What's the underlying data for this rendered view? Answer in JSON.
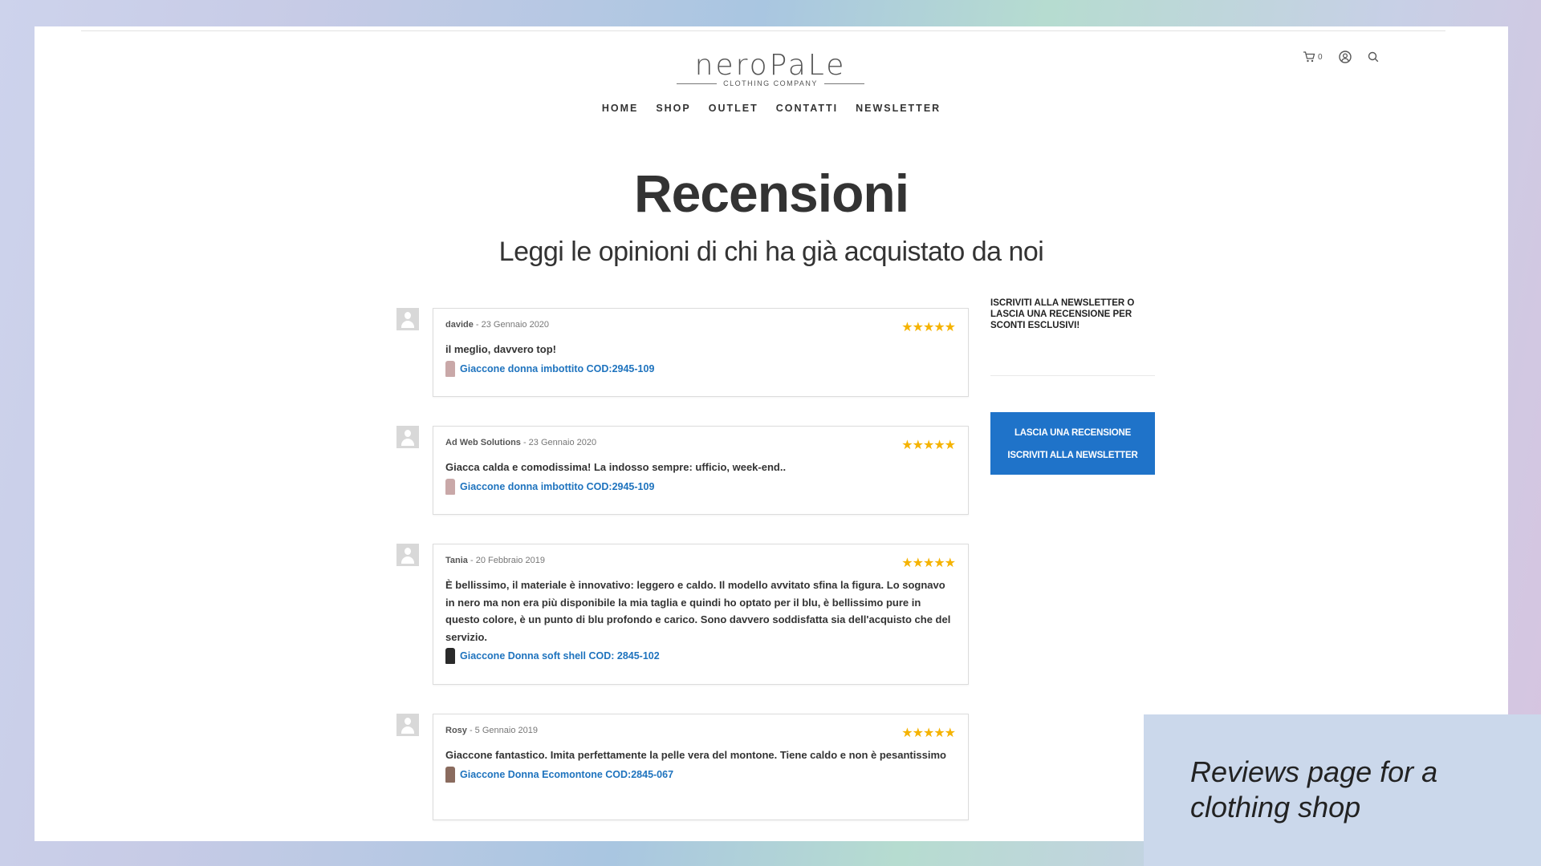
{
  "header": {
    "logo_word": "neroPaLe",
    "logo_sub": "CLOTHING COMPANY",
    "cart_count": "0",
    "icons": [
      "cart-icon",
      "account-icon",
      "search-icon"
    ]
  },
  "nav": {
    "items": [
      "HOME",
      "SHOP",
      "OUTLET",
      "CONTATTI",
      "NEWSLETTER"
    ]
  },
  "main": {
    "title": "Recensioni",
    "subtitle": "Leggi le opinioni di chi ha già acquistato da noi"
  },
  "reviews": [
    {
      "author": "davide",
      "date": " - 23 Gennaio 2020",
      "rating": 5,
      "stars": "★★★★★",
      "text": "il meglio, davvero top!",
      "product": "Giaccone donna imbottito COD:2945-109",
      "thumb_color": "#c9a8a8"
    },
    {
      "author": "Ad Web Solutions",
      "date": " - 23 Gennaio 2020",
      "rating": 5,
      "stars": "★★★★★",
      "text": "Giacca calda e comodissima! La indosso sempre: ufficio, week-end..",
      "product": "Giaccone donna imbottito COD:2945-109",
      "thumb_color": "#c9a8a8"
    },
    {
      "author": "Tania",
      "date": " - 20 Febbraio 2019",
      "rating": 5,
      "stars": "★★★★★",
      "text": "È bellissimo, il materiale è innovativo: leggero e caldo. Il modello avvitato sfina la figura. Lo sognavo in nero ma non era più disponibile la mia taglia e quindi ho optato per il blu, è bellissimo pure in questo colore, è un punto di blu profondo e carico. Sono davvero soddisfatta sia dell'acquisto che del servizio.",
      "product": "Giaccone Donna soft shell COD: 2845-102",
      "thumb_color": "#2a2a2a"
    },
    {
      "author": "Rosy",
      "date": " - 5 Gennaio 2019",
      "rating": 5,
      "stars": "★★★★★",
      "text": "Giaccone fantastico. Imita perfettamente la pelle vera del montone. Tiene caldo e non è pesantissimo",
      "product": "Giaccone Donna Ecomontone COD:2845-067",
      "thumb_color": "#8a6b5e"
    }
  ],
  "sidebar": {
    "text": "ISCRIVITI ALLA NEWSLETTER O LASCIA UNA RECENSIONE PER SCONTI ESCLUSIVI!",
    "button_review": "LASCIA UNA RECENSIONE",
    "button_newsletter": "ISCRIVITI ALLA NEWSLETTER",
    "button_color": "#1f73c9"
  },
  "caption": "Reviews page for a clothing shop"
}
